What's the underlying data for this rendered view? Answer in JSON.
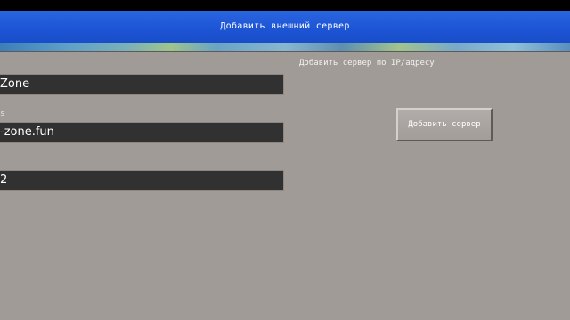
{
  "header": {
    "title": "Добавить внешний сервер"
  },
  "form": {
    "hint": "Добавить сервер по IP/адресу",
    "fields": [
      {
        "name": "server-name",
        "label": "",
        "value": "Zone"
      },
      {
        "name": "server-address",
        "label": "s",
        "value": "-zone.fun"
      },
      {
        "name": "server-port",
        "label": "",
        "value": "2"
      }
    ]
  },
  "actions": {
    "add_label": "Добавить сервер"
  },
  "colors": {
    "header": "#1d55d6",
    "background": "#a19b97",
    "field": "#313131"
  }
}
